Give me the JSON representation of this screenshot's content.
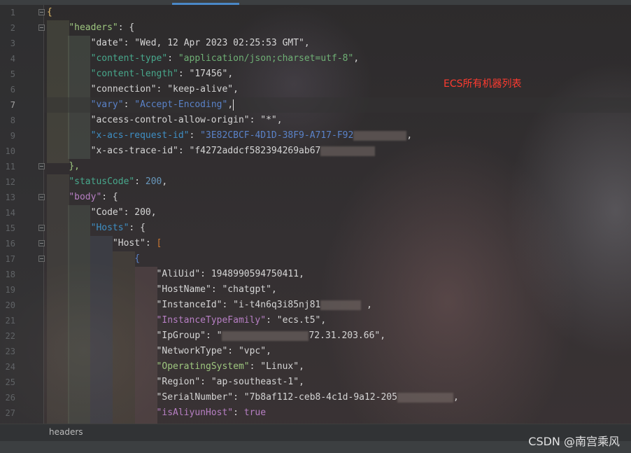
{
  "editor": {
    "active_line": "7",
    "lines": [
      {
        "num": "1"
      },
      {
        "num": "2"
      },
      {
        "num": "3"
      },
      {
        "num": "4"
      },
      {
        "num": "5"
      },
      {
        "num": "6"
      },
      {
        "num": "7"
      },
      {
        "num": "8"
      },
      {
        "num": "9"
      },
      {
        "num": "10"
      },
      {
        "num": "11"
      },
      {
        "num": "12"
      },
      {
        "num": "13"
      },
      {
        "num": "14"
      },
      {
        "num": "15"
      },
      {
        "num": "16"
      },
      {
        "num": "17"
      },
      {
        "num": "18"
      },
      {
        "num": "19"
      },
      {
        "num": "20"
      },
      {
        "num": "21"
      },
      {
        "num": "22"
      },
      {
        "num": "23"
      },
      {
        "num": "24"
      },
      {
        "num": "25"
      },
      {
        "num": "26"
      },
      {
        "num": "27"
      }
    ],
    "code": {
      "l1_open": "{",
      "headers_key": "\"headers\"",
      "date_key": "\"date\"",
      "date_val": "\"Wed, 12 Apr 2023 02:25:53 GMT\"",
      "ctype_key": "\"content-type\"",
      "ctype_val": "\"application/json;charset=utf-8\"",
      "clen_key": "\"content-length\"",
      "clen_val": "\"17456\"",
      "conn_key": "\"connection\"",
      "conn_val": "\"keep-alive\"",
      "vary_key": "\"vary\"",
      "vary_val": "\"Accept-Encoding\"",
      "acao_key": "\"access-control-allow-origin\"",
      "acao_val": "\"*\"",
      "reqid_key": "\"x-acs-request-id\"",
      "reqid_val": "\"3E82CBCF-4D1D-38F9-A717-F92",
      "trace_key": "\"x-acs-trace-id\"",
      "trace_val": "\"f4272addcf582394269ab67",
      "close_headers": "},",
      "status_key": "\"statusCode\"",
      "status_val": "200",
      "body_key": "\"body\"",
      "code_key": "\"Code\"",
      "code_val": "200",
      "hosts_key": "\"Hosts\"",
      "host_key": "\"Host\"",
      "item_open": "{",
      "aliuid_key": "\"AliUid\"",
      "aliuid_val": "1948990594750411",
      "hostname_key": "\"HostName\"",
      "hostname_val": "\"chatgpt\"",
      "instid_key": "\"InstanceId\"",
      "instid_val": "\"i-t4n6q3i85nj81",
      "itf_key": "\"InstanceTypeFamily\"",
      "itf_val": "\"ecs.t5\"",
      "ipgroup_key": "\"IpGroup\"",
      "ipgroup_val_start": "\"",
      "ipgroup_val_end": "72.31.203.66\"",
      "nettype_key": "\"NetworkType\"",
      "nettype_val": "\"vpc\"",
      "os_key": "\"OperatingSystem\"",
      "os_val": "\"Linux\"",
      "region_key": "\"Region\"",
      "region_val": "\"ap-southeast-1\"",
      "serial_key": "\"SerialNumber\"",
      "serial_val": "\"7b8af112-ceb8-4c1d-9a12-205",
      "aliyun_key": "\"isAliyunHost\"",
      "aliyun_val": "true"
    }
  },
  "annotation": "ECS所有机器列表",
  "breadcrumb": "headers",
  "watermark": "CSDN @南宫乘风",
  "colors": {
    "background": "#2b2b2b",
    "annotation": "#ff3b30",
    "tab_indicator": "#4a88c7"
  }
}
